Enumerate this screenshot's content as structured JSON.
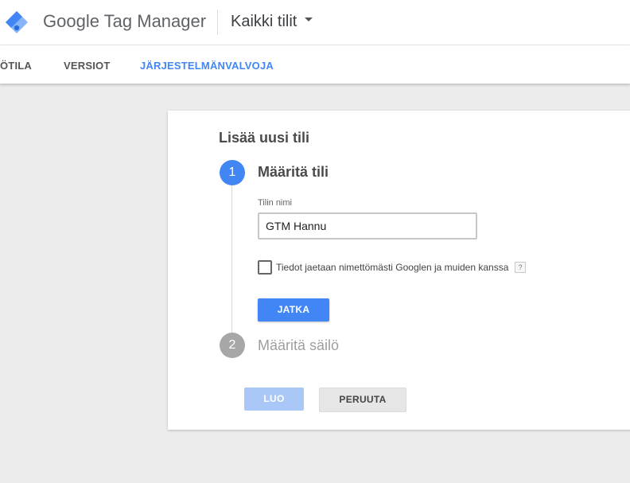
{
  "header": {
    "product_name": "Google Tag Manager",
    "account_selector_label": "Kaikki tilit",
    "logo_icon": "tag-manager-logo-icon",
    "dropdown_icon": "caret-down-icon"
  },
  "tabs": [
    {
      "label": "ÖTILA",
      "active": false
    },
    {
      "label": "VERSIOT",
      "active": false
    },
    {
      "label": "JÄRJESTELMÄNVALVOJA",
      "active": true
    }
  ],
  "card": {
    "title": "Lisää uusi tili",
    "step1": {
      "number": "1",
      "title": "Määritä tili",
      "field_label": "Tilin nimi",
      "field_value": "GTM Hannu",
      "checkbox_label": "Tiedot jaetaan nimettömästi Googlen ja muiden kanssa",
      "checkbox_checked": false,
      "help_label": "?",
      "continue_button": "JATKA"
    },
    "step2": {
      "number": "2",
      "title": "Määritä säilö"
    },
    "create_button": "LUO",
    "cancel_button": "PERUUTA"
  },
  "colors": {
    "accent": "#4285f4",
    "accent_disabled": "#a9c8f8",
    "step_inactive": "#a7a7a7",
    "background": "#ececec"
  }
}
